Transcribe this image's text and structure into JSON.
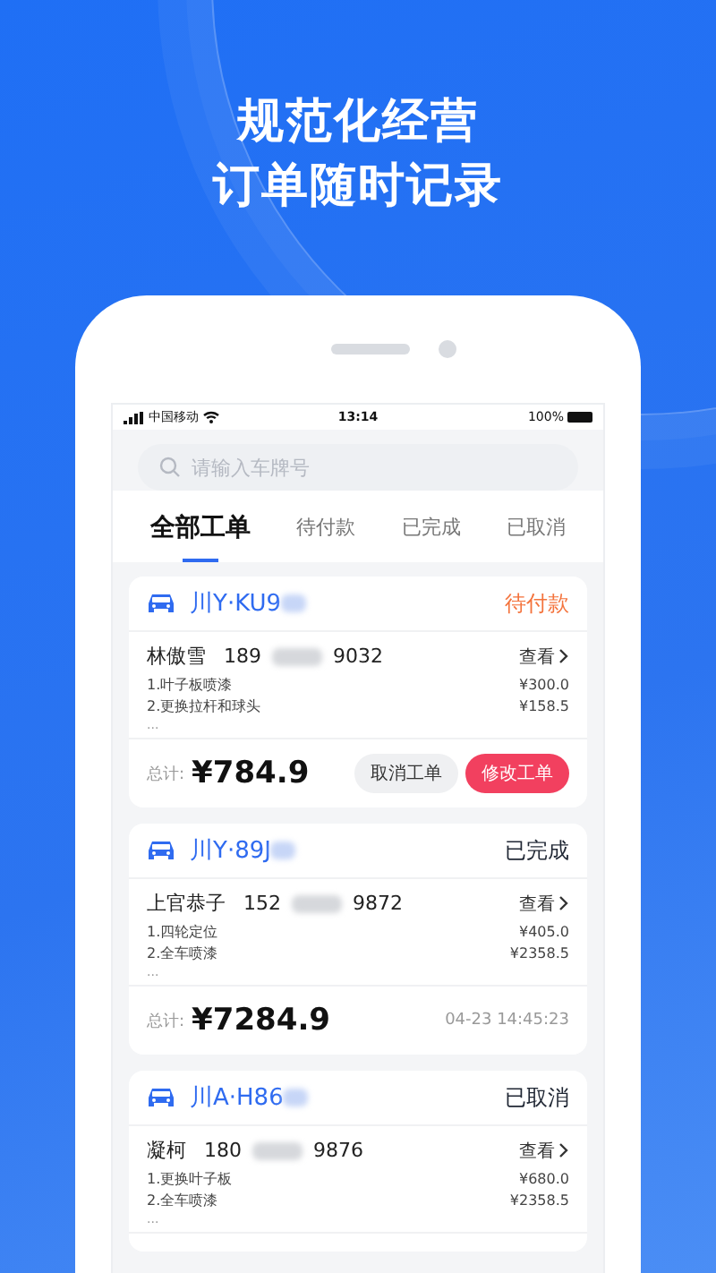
{
  "headline": [
    "规范化经营",
    "订单随时记录"
  ],
  "status_bar": {
    "carrier": "中国移动",
    "time": "13:14",
    "battery": "100%"
  },
  "search": {
    "placeholder": "请输入车牌号"
  },
  "tabs": [
    {
      "label": "全部工单",
      "selected": true
    },
    {
      "label": "待付款",
      "selected": false
    },
    {
      "label": "已完成",
      "selected": false
    },
    {
      "label": "已取消",
      "selected": false
    }
  ],
  "orders": [
    {
      "plate": "川Y·KU9",
      "status": "待付款",
      "color": "#f4733c",
      "name": "林傲雪",
      "phone_start": "189",
      "phone_end": "9032",
      "view": "查看",
      "items": [
        {
          "label": "1.叶子板喷漆",
          "price": "¥300.0"
        },
        {
          "label": "2.更换拉杆和球头",
          "price": "¥158.5"
        }
      ],
      "more": "...",
      "footer": {
        "kind": "buttons",
        "total_label": "总计:",
        "total": "¥784.9",
        "buttons": [
          {
            "label": "取消工单",
            "kind": "secondary"
          },
          {
            "label": "修改工单",
            "kind": "primary"
          }
        ]
      }
    },
    {
      "plate": "川Y·89J",
      "status": "已完成",
      "color": "#1f2633",
      "name": "上官恭子",
      "phone_start": "152",
      "phone_end": "9872",
      "view": "查看",
      "items": [
        {
          "label": "1.四轮定位",
          "price": "¥405.0"
        },
        {
          "label": "2.全车喷漆",
          "price": "¥2358.5"
        }
      ],
      "more": "...",
      "footer": {
        "kind": "time",
        "total_label": "总计:",
        "total": "¥7284.9",
        "time": "04-23 14:45:23"
      }
    },
    {
      "plate": "川A·H86",
      "status": "已取消",
      "color": "#1f2633",
      "name": "凝柯",
      "phone_start": "180",
      "phone_end": "9876",
      "view": "查看",
      "items": [
        {
          "label": "1.更换叶子板",
          "price": "¥680.0"
        },
        {
          "label": "2.全车喷漆",
          "price": "¥2358.5"
        }
      ],
      "more": "..."
    }
  ]
}
